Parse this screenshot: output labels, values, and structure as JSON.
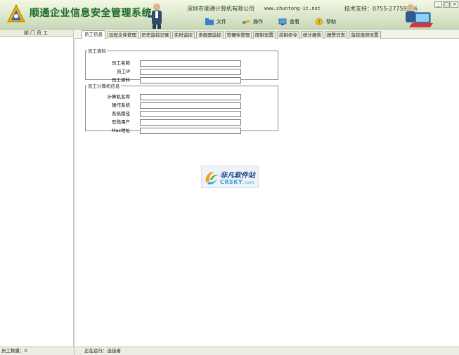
{
  "header": {
    "app_title": "顺通企业信息安全管理系统",
    "company": "深圳市顺通计算机有限公司",
    "website": "www.shuntong-it.net",
    "support": "技术支持：0755-27759286",
    "menu": [
      {
        "label": "文件",
        "icon": "folder-icon"
      },
      {
        "label": "操作",
        "icon": "tools-icon"
      },
      {
        "label": "查看",
        "icon": "view-icon"
      },
      {
        "label": "帮助",
        "icon": "help-icon"
      }
    ],
    "window_buttons": {
      "minimize": "_",
      "maximize": "□",
      "close": "×"
    }
  },
  "left_panel": {
    "header": "部门员工"
  },
  "tabs": [
    {
      "label": "员工信息",
      "active": true
    },
    {
      "label": "远程文件管理",
      "active": false
    },
    {
      "label": "历史监控记录",
      "active": false
    },
    {
      "label": "实时监控",
      "active": false
    },
    {
      "label": "多画面监控",
      "active": false
    },
    {
      "label": "软硬件管理",
      "active": false
    },
    {
      "label": "限制设置",
      "active": false
    },
    {
      "label": "控制命令",
      "active": false
    },
    {
      "label": "统计报告",
      "active": false
    },
    {
      "label": "报警日志",
      "active": false
    },
    {
      "label": "监控选项设置",
      "active": false
    }
  ],
  "employee_info": {
    "legend": "员工资料",
    "fields": [
      {
        "label": "员工名称",
        "value": ""
      },
      {
        "label": "员工IP",
        "value": ""
      },
      {
        "label": "员工资料",
        "value": ""
      }
    ]
  },
  "computer_info": {
    "legend": "员工计算机信息",
    "fields": [
      {
        "label": "计算机名称",
        "value": ""
      },
      {
        "label": "操作系统",
        "value": ""
      },
      {
        "label": "系统路径",
        "value": ""
      },
      {
        "label": "登陆用户",
        "value": ""
      },
      {
        "label": "Mac地址",
        "value": ""
      }
    ]
  },
  "watermark": {
    "cn": "非凡软件站",
    "en": "CRSKY",
    "en_suffix": ".com"
  },
  "statusbar": {
    "employee_count": "员工数量：0",
    "online": "正在运行：连接者"
  },
  "colors": {
    "banner": "#dfead0",
    "title_green": "#1f6b2a",
    "tab_active": "#ffffff",
    "tab_inactive": "#e3ead8"
  }
}
